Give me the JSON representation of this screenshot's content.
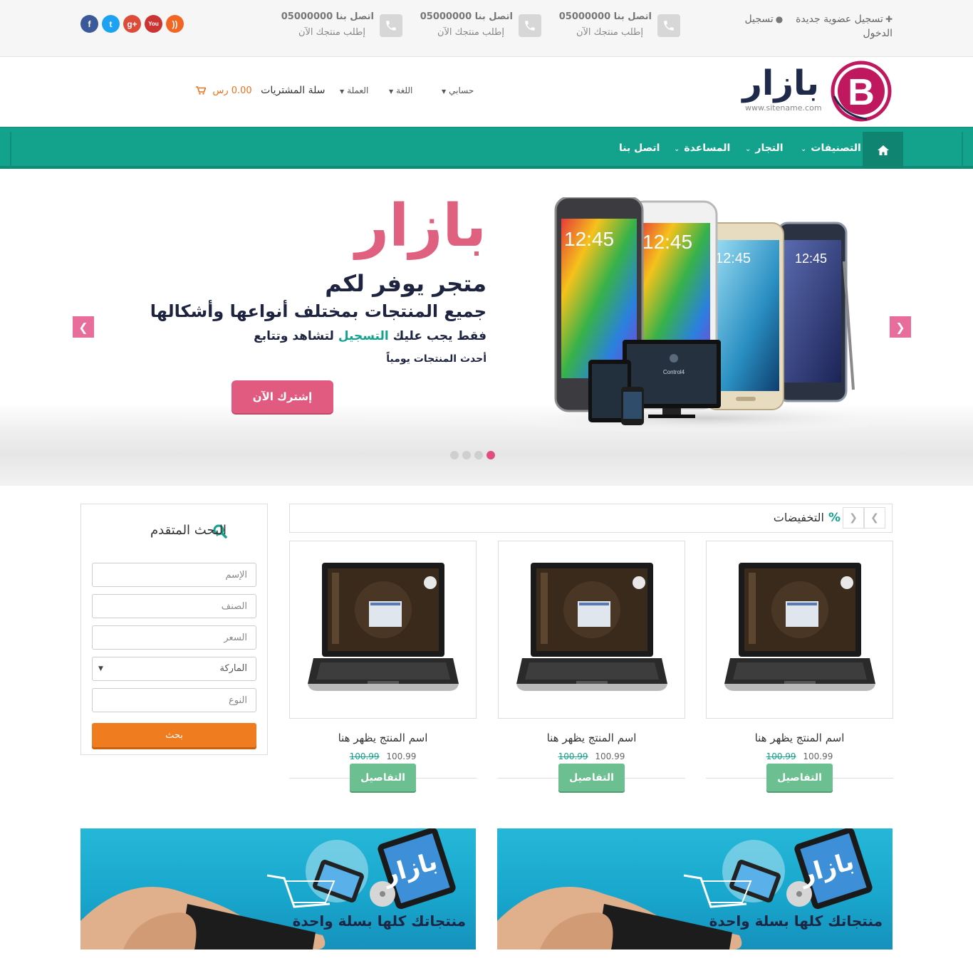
{
  "topbar": {
    "register_label": "تسجيل عضوية جديدة",
    "login_label": "تسجيل الدخول",
    "contacts": [
      {
        "title": "اتصل بنا 05000000",
        "subtitle": "إطلب منتجك الآن"
      },
      {
        "title": "اتصل بنا 05000000",
        "subtitle": "إطلب منتجك الآن"
      },
      {
        "title": "اتصل بنا 05000000",
        "subtitle": "إطلب منتجك الآن"
      }
    ],
    "social": [
      {
        "name": "facebook-icon",
        "glyph": "f",
        "color": "#3b5998"
      },
      {
        "name": "twitter-icon",
        "glyph": "t",
        "color": "#1da1f2"
      },
      {
        "name": "google-plus-icon",
        "glyph": "g+",
        "color": "#dd4b39"
      },
      {
        "name": "youtube-icon",
        "glyph": "You",
        "color": "#cc3333"
      },
      {
        "name": "rss-icon",
        "glyph": "))",
        "color": "#f26522"
      }
    ]
  },
  "header": {
    "logo_text": "بازار",
    "logo_site": "www.sitename.com",
    "account_label": "حسابي",
    "language_label": "اللغة",
    "currency_label": "العملة",
    "cart_label": "سلة المشتريات",
    "cart_amount": "0.00 رس"
  },
  "nav": {
    "items": [
      {
        "label": "التصنيفات"
      },
      {
        "label": "التجار"
      },
      {
        "label": "المساعدة"
      },
      {
        "label": "اتصل بنا"
      }
    ]
  },
  "slider": {
    "headline": "بازار",
    "line1": "متجر يوفر لكم",
    "line2": "جميع المنتجات بمختلف أنواعها وأشكالها",
    "line3_a": "فقط يجب عليك",
    "line3_highlight": "التسجيل",
    "line3_b": "لتشاهد وتتابع",
    "line4": "أحدث المنتجات يومياً",
    "cta": "إشترك الآن",
    "active_slide": 1,
    "slide_count": 4,
    "device_screen_time": "12:45",
    "tv_label": "Control4"
  },
  "discounts": {
    "title": "التخفيضات",
    "icon": "%",
    "products": [
      {
        "name": "اسم المنتج يظهر هنا",
        "price": "100.99",
        "old_price": "100.99",
        "button": "التفاصيل"
      },
      {
        "name": "اسم المنتج يظهر هنا",
        "price": "100.99",
        "old_price": "100.99",
        "button": "التفاصيل"
      },
      {
        "name": "اسم المنتج يظهر هنا",
        "price": "100.99",
        "old_price": "100.99",
        "button": "التفاصيل"
      }
    ]
  },
  "search": {
    "title": "البحث المتقدم",
    "name_placeholder": "الإسم",
    "category_placeholder": "الصنف",
    "price_placeholder": "السعر",
    "brand_value": "الماركة",
    "type_placeholder": "النوع",
    "button": "بحث"
  },
  "banners": [
    {
      "caption": "منتجاتك كلها بسلة واحدة",
      "logo": "بازار"
    },
    {
      "caption": "منتجاتك كلها بسلة واحدة",
      "logo": "بازار"
    }
  ],
  "colors": {
    "primary": "#13a38c",
    "accent": "#e15b80",
    "orange": "#ef7c1f",
    "navy": "#1e2440"
  }
}
